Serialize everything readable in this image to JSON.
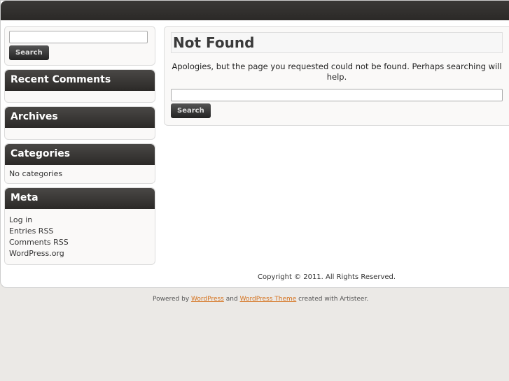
{
  "sidebar": {
    "search_button": "Search",
    "recent_comments": "Recent Comments",
    "archives": "Archives",
    "categories": "Categories",
    "no_categories": "No categories",
    "meta": "Meta",
    "meta_links": [
      "Log in",
      "Entries RSS",
      "Comments RSS",
      "WordPress.org"
    ]
  },
  "main": {
    "title": "Not Found",
    "message": "Apologies, but the page you requested could not be found. Perhaps searching will help.",
    "search_button": "Search"
  },
  "footer": {
    "copyright": "Copyright © 2011. All Rights Reserved.",
    "powered_by": "Powered by",
    "wordpress": "WordPress",
    "and": "and",
    "theme": "WordPress Theme",
    "created": "created with Artisteer."
  }
}
